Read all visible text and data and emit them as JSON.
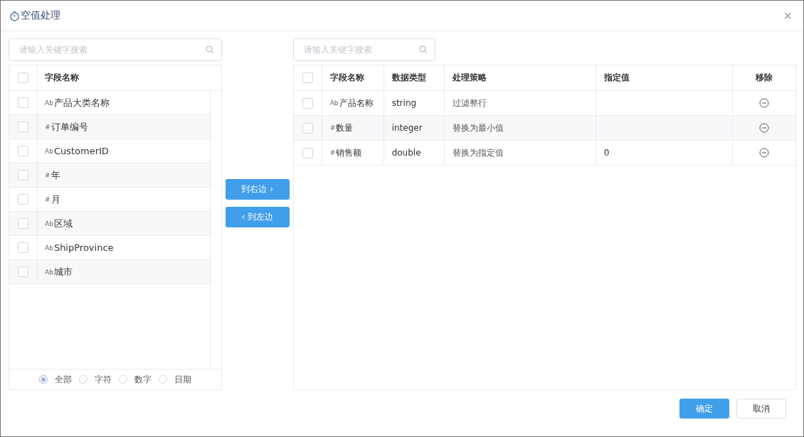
{
  "dialog": {
    "title": "空值处理",
    "close": "×"
  },
  "left": {
    "search": {
      "placeholder": "请输入关键字搜索"
    },
    "header": {
      "checked": false,
      "label": "字段名称"
    },
    "rows": [
      {
        "type_icon": "Ab",
        "name": "产品大类名称",
        "checked": false
      },
      {
        "type_icon": "#",
        "name": "订单编号",
        "checked": false
      },
      {
        "type_icon": "Ab",
        "name": "CustomerID",
        "checked": false
      },
      {
        "type_icon": "#",
        "name": "年",
        "checked": false
      },
      {
        "type_icon": "#",
        "name": "月",
        "checked": false
      },
      {
        "type_icon": "Ab",
        "name": "区域",
        "checked": false
      },
      {
        "type_icon": "Ab",
        "name": "ShipProvince",
        "checked": false
      },
      {
        "type_icon": "Ab",
        "name": "城市",
        "checked": false
      }
    ],
    "filters": [
      {
        "label": "全部",
        "selected": true
      },
      {
        "label": "字符",
        "selected": false
      },
      {
        "label": "数字",
        "selected": false
      },
      {
        "label": "日期",
        "selected": false
      }
    ]
  },
  "transfer": {
    "to_right": "到右边 ›",
    "to_left": "‹ 到左边"
  },
  "right": {
    "search": {
      "placeholder": "请输入关键字搜索"
    },
    "header_checked": false,
    "columns": [
      "字段名称",
      "数据类型",
      "处理策略",
      "指定值",
      "移除"
    ],
    "rows": [
      {
        "checked": false,
        "type_icon": "Ab",
        "name": "产品名称",
        "data_type": "string",
        "strategy": "过滤整行",
        "value": ""
      },
      {
        "checked": false,
        "type_icon": "#",
        "name": "数量",
        "data_type": "integer",
        "strategy": "替换为最小值",
        "value": ""
      },
      {
        "checked": false,
        "type_icon": "#",
        "name": "销售额",
        "data_type": "double",
        "strategy": "替换为指定值",
        "value": "0"
      }
    ]
  },
  "buttons": {
    "ok": "确定",
    "cancel": "取消"
  }
}
